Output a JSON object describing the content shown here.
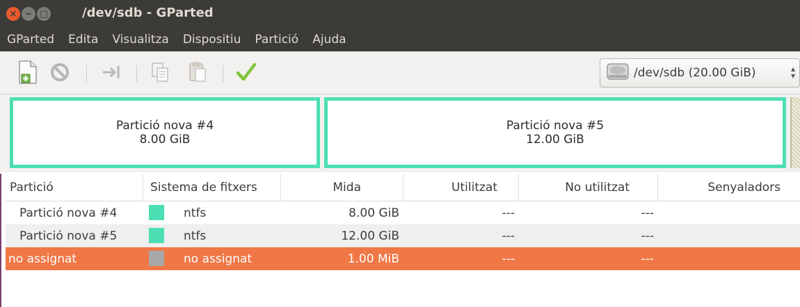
{
  "window": {
    "title": "/dev/sdb - GParted"
  },
  "menu": [
    "GParted",
    "Edita",
    "Visualitza",
    "Dispositiu",
    "Partició",
    "Ajuda"
  ],
  "toolbar": {
    "icons": [
      "new-partition-icon",
      "delete-icon",
      "resize-move-icon",
      "copy-icon",
      "paste-icon",
      "apply-icon"
    ],
    "device_selector": "/dev/sdb  (20.00 GiB)"
  },
  "graphic": {
    "partitions": [
      {
        "name": "Partició nova #4",
        "size": "8.00 GiB",
        "color": "#4ddfb3"
      },
      {
        "name": "Partició nova #5",
        "size": "12.00 GiB",
        "color": "#4ddfb3"
      }
    ]
  },
  "table": {
    "headers": [
      "Partició",
      "Sistema de fitxers",
      "Mida",
      "Utilitzat",
      "No utilitzat",
      "Senyaladors"
    ],
    "rows": [
      {
        "partition": "Partició nova #4",
        "fs_color": "#4ddfb3",
        "filesystem": "ntfs",
        "size": "8.00 GiB",
        "used": "---",
        "unused": "---",
        "flags": ""
      },
      {
        "partition": "Partició nova #5",
        "fs_color": "#4ddfb3",
        "filesystem": "ntfs",
        "size": "12.00 GiB",
        "used": "---",
        "unused": "---",
        "flags": ""
      },
      {
        "partition": "no assignat",
        "fs_color": "#a8a8a8",
        "filesystem": "no assignat",
        "size": "1.00 MiB",
        "used": "---",
        "unused": "---",
        "flags": "",
        "selected": true
      }
    ]
  },
  "colors": {
    "accent_selection": "#f07746",
    "ntfs": "#4ddfb3",
    "unallocated": "#a8a8a8",
    "titlebar": "#3c3b37"
  }
}
